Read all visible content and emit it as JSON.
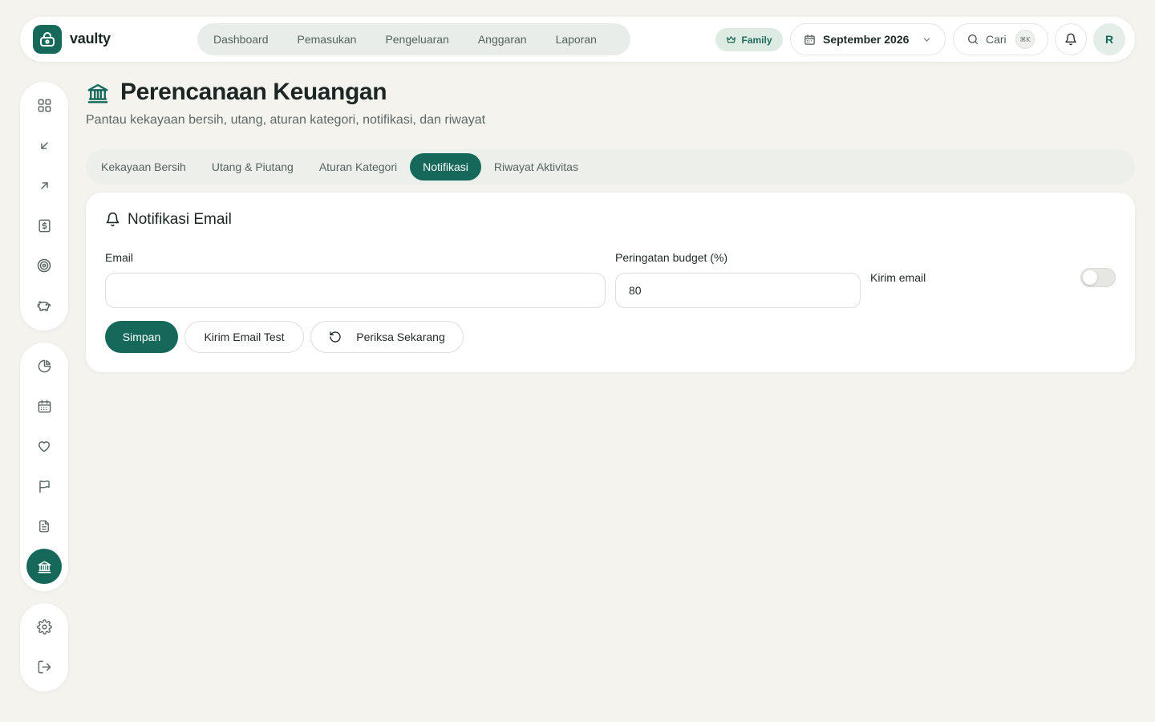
{
  "brand": {
    "name": "vaulty"
  },
  "nav": {
    "items": [
      {
        "label": "Dashboard"
      },
      {
        "label": "Pemasukan"
      },
      {
        "label": "Pengeluaran"
      },
      {
        "label": "Anggaran"
      },
      {
        "label": "Laporan"
      }
    ]
  },
  "header": {
    "plan_badge": "Family",
    "month": "September 2026",
    "search_label": "Cari",
    "search_shortcut": "⌘K",
    "avatar_initial": "R"
  },
  "sidebar": {
    "group1": [
      "dashboard-grid-icon",
      "income-arrow-icon",
      "expense-arrow-icon",
      "budget-dollar-icon",
      "target-icon",
      "savings-piggy-icon"
    ],
    "group2": [
      "report-pie-icon",
      "calendar-icon",
      "wishlist-heart-icon",
      "goals-flag-icon",
      "document-icon",
      "planning-bank-icon"
    ],
    "group3": [
      "settings-gear-icon",
      "logout-icon"
    ],
    "active": "planning-bank-icon"
  },
  "page": {
    "title": "Perencanaan Keuangan",
    "subtitle": "Pantau kekayaan bersih, utang, aturan kategori, notifikasi, dan riwayat"
  },
  "tabs": {
    "items": [
      {
        "label": "Kekayaan Bersih"
      },
      {
        "label": "Utang & Piutang"
      },
      {
        "label": "Aturan Kategori"
      },
      {
        "label": "Notifikasi"
      },
      {
        "label": "Riwayat Aktivitas"
      }
    ],
    "active_index": 3
  },
  "notification_card": {
    "title": "Notifikasi Email",
    "email_label": "Email",
    "email_value": "",
    "budget_label": "Peringatan budget (%)",
    "budget_value": "80",
    "send_email_label": "Kirim email",
    "send_email_enabled": false,
    "save_button": "Simpan",
    "test_button": "Kirim Email Test",
    "check_button": "Periksa Sekarang"
  },
  "colors": {
    "primary": "#16695a",
    "background": "#f4f3ee",
    "card": "#ffffff"
  }
}
